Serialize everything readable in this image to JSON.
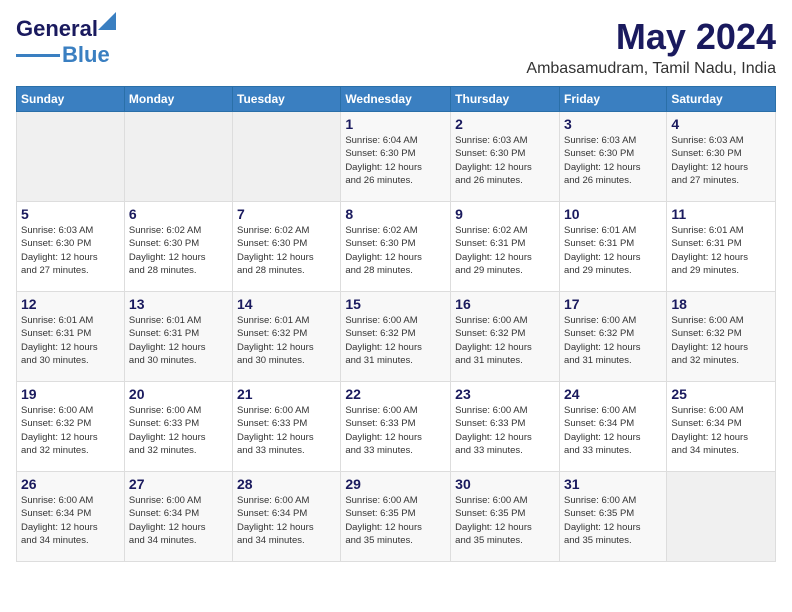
{
  "header": {
    "logo_line1": "General",
    "logo_line2": "Blue",
    "month_year": "May 2024",
    "location": "Ambasamudram, Tamil Nadu, India"
  },
  "days_of_week": [
    "Sunday",
    "Monday",
    "Tuesday",
    "Wednesday",
    "Thursday",
    "Friday",
    "Saturday"
  ],
  "weeks": [
    [
      {
        "day": "",
        "info": ""
      },
      {
        "day": "",
        "info": ""
      },
      {
        "day": "",
        "info": ""
      },
      {
        "day": "1",
        "info": "Sunrise: 6:04 AM\nSunset: 6:30 PM\nDaylight: 12 hours\nand 26 minutes."
      },
      {
        "day": "2",
        "info": "Sunrise: 6:03 AM\nSunset: 6:30 PM\nDaylight: 12 hours\nand 26 minutes."
      },
      {
        "day": "3",
        "info": "Sunrise: 6:03 AM\nSunset: 6:30 PM\nDaylight: 12 hours\nand 26 minutes."
      },
      {
        "day": "4",
        "info": "Sunrise: 6:03 AM\nSunset: 6:30 PM\nDaylight: 12 hours\nand 27 minutes."
      }
    ],
    [
      {
        "day": "5",
        "info": "Sunrise: 6:03 AM\nSunset: 6:30 PM\nDaylight: 12 hours\nand 27 minutes."
      },
      {
        "day": "6",
        "info": "Sunrise: 6:02 AM\nSunset: 6:30 PM\nDaylight: 12 hours\nand 28 minutes."
      },
      {
        "day": "7",
        "info": "Sunrise: 6:02 AM\nSunset: 6:30 PM\nDaylight: 12 hours\nand 28 minutes."
      },
      {
        "day": "8",
        "info": "Sunrise: 6:02 AM\nSunset: 6:30 PM\nDaylight: 12 hours\nand 28 minutes."
      },
      {
        "day": "9",
        "info": "Sunrise: 6:02 AM\nSunset: 6:31 PM\nDaylight: 12 hours\nand 29 minutes."
      },
      {
        "day": "10",
        "info": "Sunrise: 6:01 AM\nSunset: 6:31 PM\nDaylight: 12 hours\nand 29 minutes."
      },
      {
        "day": "11",
        "info": "Sunrise: 6:01 AM\nSunset: 6:31 PM\nDaylight: 12 hours\nand 29 minutes."
      }
    ],
    [
      {
        "day": "12",
        "info": "Sunrise: 6:01 AM\nSunset: 6:31 PM\nDaylight: 12 hours\nand 30 minutes."
      },
      {
        "day": "13",
        "info": "Sunrise: 6:01 AM\nSunset: 6:31 PM\nDaylight: 12 hours\nand 30 minutes."
      },
      {
        "day": "14",
        "info": "Sunrise: 6:01 AM\nSunset: 6:32 PM\nDaylight: 12 hours\nand 30 minutes."
      },
      {
        "day": "15",
        "info": "Sunrise: 6:00 AM\nSunset: 6:32 PM\nDaylight: 12 hours\nand 31 minutes."
      },
      {
        "day": "16",
        "info": "Sunrise: 6:00 AM\nSunset: 6:32 PM\nDaylight: 12 hours\nand 31 minutes."
      },
      {
        "day": "17",
        "info": "Sunrise: 6:00 AM\nSunset: 6:32 PM\nDaylight: 12 hours\nand 31 minutes."
      },
      {
        "day": "18",
        "info": "Sunrise: 6:00 AM\nSunset: 6:32 PM\nDaylight: 12 hours\nand 32 minutes."
      }
    ],
    [
      {
        "day": "19",
        "info": "Sunrise: 6:00 AM\nSunset: 6:32 PM\nDaylight: 12 hours\nand 32 minutes."
      },
      {
        "day": "20",
        "info": "Sunrise: 6:00 AM\nSunset: 6:33 PM\nDaylight: 12 hours\nand 32 minutes."
      },
      {
        "day": "21",
        "info": "Sunrise: 6:00 AM\nSunset: 6:33 PM\nDaylight: 12 hours\nand 33 minutes."
      },
      {
        "day": "22",
        "info": "Sunrise: 6:00 AM\nSunset: 6:33 PM\nDaylight: 12 hours\nand 33 minutes."
      },
      {
        "day": "23",
        "info": "Sunrise: 6:00 AM\nSunset: 6:33 PM\nDaylight: 12 hours\nand 33 minutes."
      },
      {
        "day": "24",
        "info": "Sunrise: 6:00 AM\nSunset: 6:34 PM\nDaylight: 12 hours\nand 33 minutes."
      },
      {
        "day": "25",
        "info": "Sunrise: 6:00 AM\nSunset: 6:34 PM\nDaylight: 12 hours\nand 34 minutes."
      }
    ],
    [
      {
        "day": "26",
        "info": "Sunrise: 6:00 AM\nSunset: 6:34 PM\nDaylight: 12 hours\nand 34 minutes."
      },
      {
        "day": "27",
        "info": "Sunrise: 6:00 AM\nSunset: 6:34 PM\nDaylight: 12 hours\nand 34 minutes."
      },
      {
        "day": "28",
        "info": "Sunrise: 6:00 AM\nSunset: 6:34 PM\nDaylight: 12 hours\nand 34 minutes."
      },
      {
        "day": "29",
        "info": "Sunrise: 6:00 AM\nSunset: 6:35 PM\nDaylight: 12 hours\nand 35 minutes."
      },
      {
        "day": "30",
        "info": "Sunrise: 6:00 AM\nSunset: 6:35 PM\nDaylight: 12 hours\nand 35 minutes."
      },
      {
        "day": "31",
        "info": "Sunrise: 6:00 AM\nSunset: 6:35 PM\nDaylight: 12 hours\nand 35 minutes."
      },
      {
        "day": "",
        "info": ""
      }
    ]
  ]
}
